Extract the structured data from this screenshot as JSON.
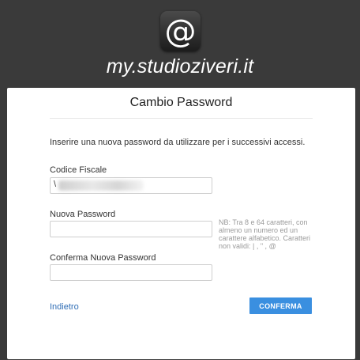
{
  "header": {
    "icon_glyph": "@",
    "site_name": "my.studioziveri.it"
  },
  "card": {
    "title": "Cambio Password",
    "intro": "Inserire una nuova password da utilizzare per i successivi accessi.",
    "fields": {
      "codice_fiscale": {
        "label": "Codice Fiscale",
        "value": "\\"
      },
      "nuova_password": {
        "label": "Nuova Password",
        "value": ""
      },
      "conferma_password": {
        "label": "Conferma Nuova Password",
        "value": ""
      }
    },
    "hint": "NB: Tra 8 e 64 caratteri, con almeno un numero ed un carattere alfabetico. Caratteri non validi: | , \" , @",
    "back_label": "Indietro",
    "confirm_label": "CONFERMA"
  },
  "colors": {
    "background": "#3a3a3a",
    "accent": "#3a8fe0",
    "link": "#2f6db5"
  }
}
